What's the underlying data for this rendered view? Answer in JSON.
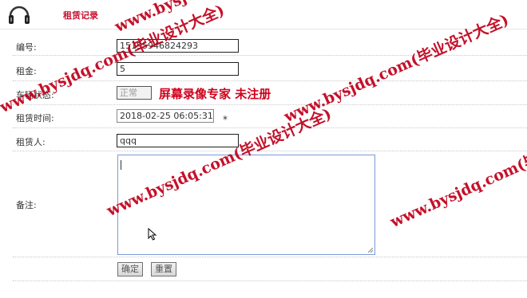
{
  "header": {
    "title": "租赁记录",
    "logo_icon": "headphones-icon"
  },
  "form": {
    "fields": [
      {
        "label": "编号:",
        "value": "15195946824293"
      },
      {
        "label": "租金:",
        "value": "5"
      },
      {
        "label": "车辆状态:",
        "value": "正常"
      },
      {
        "label": "租赁时间:",
        "value": "2018-02-25 06:05:31",
        "required_mark": "*"
      },
      {
        "label": "租赁人:",
        "value": "qqq"
      },
      {
        "label": "备注:",
        "value": ""
      }
    ],
    "submit_label": "确定",
    "reset_label": "重置"
  },
  "overlay": {
    "banner": "屏幕录像专家 未注册",
    "watermark_a": "www.bysjdq.com(毕业设计大全)",
    "watermark_b": "www.bysjdq.com(毕业设计大全)",
    "watermark_c": "www.bysjdq.com(毕业设计大全)",
    "watermark_d": "www.bysjdq.com(毕业设计大全)",
    "watermark_e": "www.bysjdq.com(毕业设计大全)",
    "color": "#c0001a"
  }
}
